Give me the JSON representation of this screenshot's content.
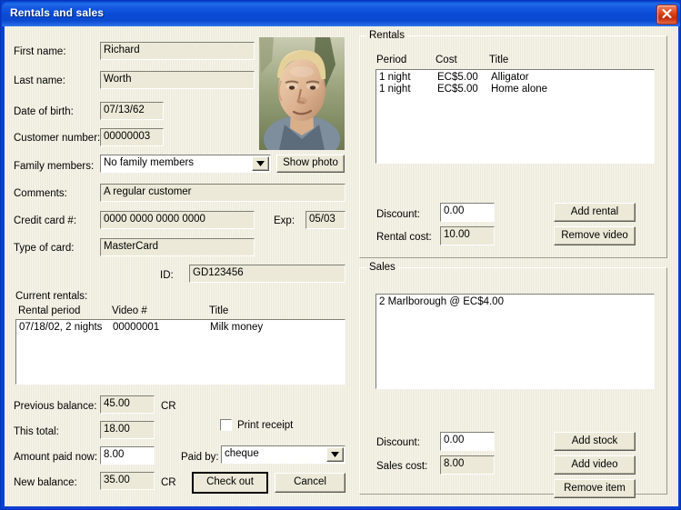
{
  "window": {
    "title": "Rentals and sales",
    "close_label": "Close",
    "titlebar_color": "#0a4bd6",
    "client_bg": "#ece9d8"
  },
  "customer": {
    "first_name_label": "First name:",
    "first_name_value": "Richard",
    "last_name_label": "Last name:",
    "last_name_value": "Worth",
    "dob_label": "Date of birth:",
    "dob_value": "07/13/62",
    "customer_number_label": "Customer number:",
    "customer_number_value": "00000003",
    "family_members_label": "Family members:",
    "family_members_value": "No family members",
    "show_photo_label": "Show photo",
    "comments_label": "Comments:",
    "comments_value": "A regular customer",
    "credit_card_label": "Credit card #:",
    "credit_card_value": "0000 0000 0000 0000",
    "exp_label": "Exp:",
    "exp_value": "05/03",
    "card_type_label": "Type of card:",
    "card_type_value": "MasterCard",
    "id_label": "ID:",
    "id_value": "GD123456"
  },
  "current_rentals": {
    "section_label": "Current rentals:",
    "columns": [
      "Rental period",
      "Video #",
      "Title"
    ],
    "rows": [
      {
        "period": "07/18/02, 2 nights",
        "video": "00000001",
        "title": "Milk money"
      }
    ]
  },
  "totals": {
    "previous_balance_label": "Previous balance:",
    "previous_balance_value": "45.00",
    "previous_balance_suffix": "CR",
    "this_total_label": "This total:",
    "this_total_value": "18.00",
    "amount_paid_label": "Amount paid now:",
    "amount_paid_value": "8.00",
    "new_balance_label": "New balance:",
    "new_balance_value": "35.00",
    "new_balance_suffix": "CR",
    "print_receipt_label": "Print receipt",
    "print_receipt_checked": false,
    "paid_by_label": "Paid by:",
    "paid_by_value": "cheque",
    "check_out_label": "Check out",
    "cancel_label": "Cancel"
  },
  "rentals": {
    "group_label": "Rentals",
    "columns": [
      "Period",
      "Cost",
      "Title"
    ],
    "rows": [
      {
        "period": "1 night",
        "cost": "EC$5.00",
        "title": "Alligator"
      },
      {
        "period": "1 night",
        "cost": "EC$5.00",
        "title": "Home alone"
      }
    ],
    "discount_label": "Discount:",
    "discount_value": "0.00",
    "rental_cost_label": "Rental cost:",
    "rental_cost_value": "10.00",
    "add_rental_label": "Add rental",
    "remove_video_label": "Remove video"
  },
  "sales": {
    "group_label": "Sales",
    "items": [
      "2 Marlborough @ EC$4.00"
    ],
    "discount_label": "Discount:",
    "discount_value": "0.00",
    "sales_cost_label": "Sales cost:",
    "sales_cost_value": "8.00",
    "add_stock_label": "Add stock",
    "add_video_label": "Add video",
    "remove_item_label": "Remove item"
  }
}
